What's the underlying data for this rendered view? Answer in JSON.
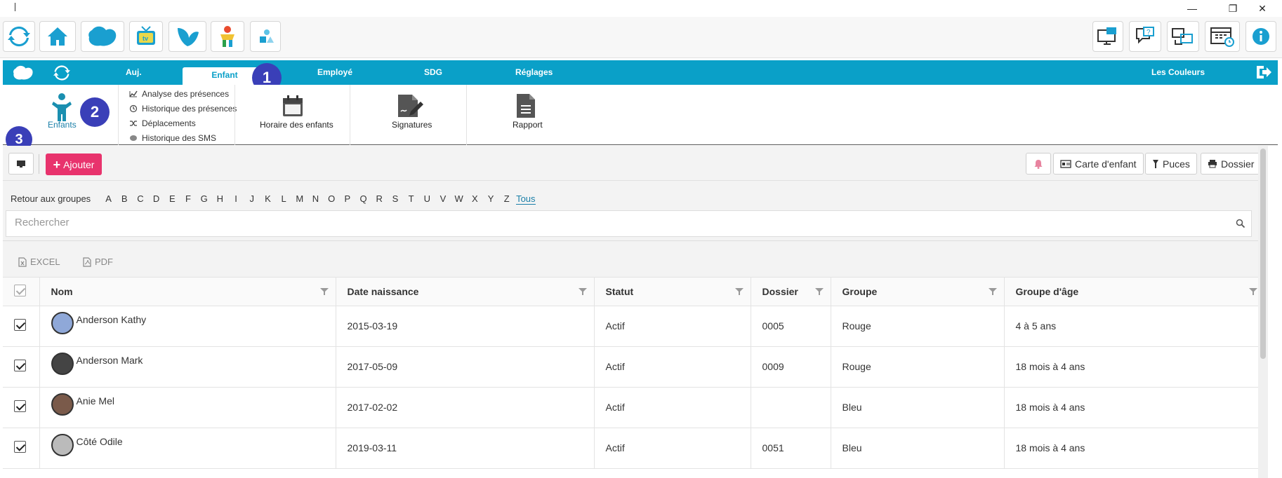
{
  "window": {
    "minimize": "—",
    "restore": "❐",
    "close": "✕"
  },
  "toolbar": {
    "left_icons": [
      "refresh-icon",
      "home-icon",
      "cloud-logo-icon",
      "tv-icon",
      "butterfly-icon",
      "kids-icon",
      "shapes-icon"
    ],
    "right_icons": [
      "monitor-message-icon",
      "help-chat-icon",
      "screen-sync-icon",
      "calendar-clock-icon",
      "info-icon"
    ]
  },
  "nav": {
    "tabs": [
      {
        "label": "Auj."
      },
      {
        "label": "Enfant"
      },
      {
        "label": "Employé"
      },
      {
        "label": "SDG"
      },
      {
        "label": "Réglages"
      }
    ],
    "center_name": "Les Couleurs",
    "accent": "#0aa0c8"
  },
  "badges": [
    "1",
    "2",
    "3"
  ],
  "ribbon": {
    "children_label": "Enfants",
    "sub_items": [
      "Analyse des présences",
      "Historique des présences",
      "Déplacements",
      "Historique des SMS"
    ],
    "schedule_label": "Horaire des enfants",
    "signatures_label": "Signatures",
    "report_label": "Rapport"
  },
  "actions": {
    "add_label": "Ajouter",
    "child_card_label": "Carte d'enfant",
    "chips_label": "Puces",
    "file_label": "Dossier",
    "add_color": "#e8336d"
  },
  "filter": {
    "back_label": "Retour aux groupes",
    "letters": [
      "A",
      "B",
      "C",
      "D",
      "E",
      "F",
      "G",
      "H",
      "I",
      "J",
      "K",
      "L",
      "M",
      "N",
      "O",
      "P",
      "Q",
      "R",
      "S",
      "T",
      "U",
      "V",
      "W",
      "X",
      "Y",
      "Z"
    ],
    "all_label": "Tous"
  },
  "search": {
    "placeholder": "Rechercher"
  },
  "export": {
    "excel_label": "EXCEL",
    "pdf_label": "PDF"
  },
  "table": {
    "columns": [
      "Nom",
      "Date naissance",
      "Statut",
      "Dossier",
      "Groupe",
      "Groupe d'âge"
    ],
    "rows": [
      {
        "name": "Anderson Kathy",
        "birth": "2015-03-19",
        "status": "Actif",
        "file": "0005",
        "group": "Rouge",
        "age_group": "4 à 5 ans",
        "checked": true
      },
      {
        "name": "Anderson Mark",
        "birth": "2017-05-09",
        "status": "Actif",
        "file": "0009",
        "group": "Rouge",
        "age_group": "18 mois à 4 ans",
        "checked": true
      },
      {
        "name": "Anie Mel",
        "birth": "2017-02-02",
        "status": "Actif",
        "file": "",
        "group": "Bleu",
        "age_group": "18 mois à 4 ans",
        "checked": true
      },
      {
        "name": "Côté Odile",
        "birth": "2019-03-11",
        "status": "Actif",
        "file": "0051",
        "group": "Bleu",
        "age_group": "18 mois à 4 ans",
        "checked": true
      }
    ]
  }
}
